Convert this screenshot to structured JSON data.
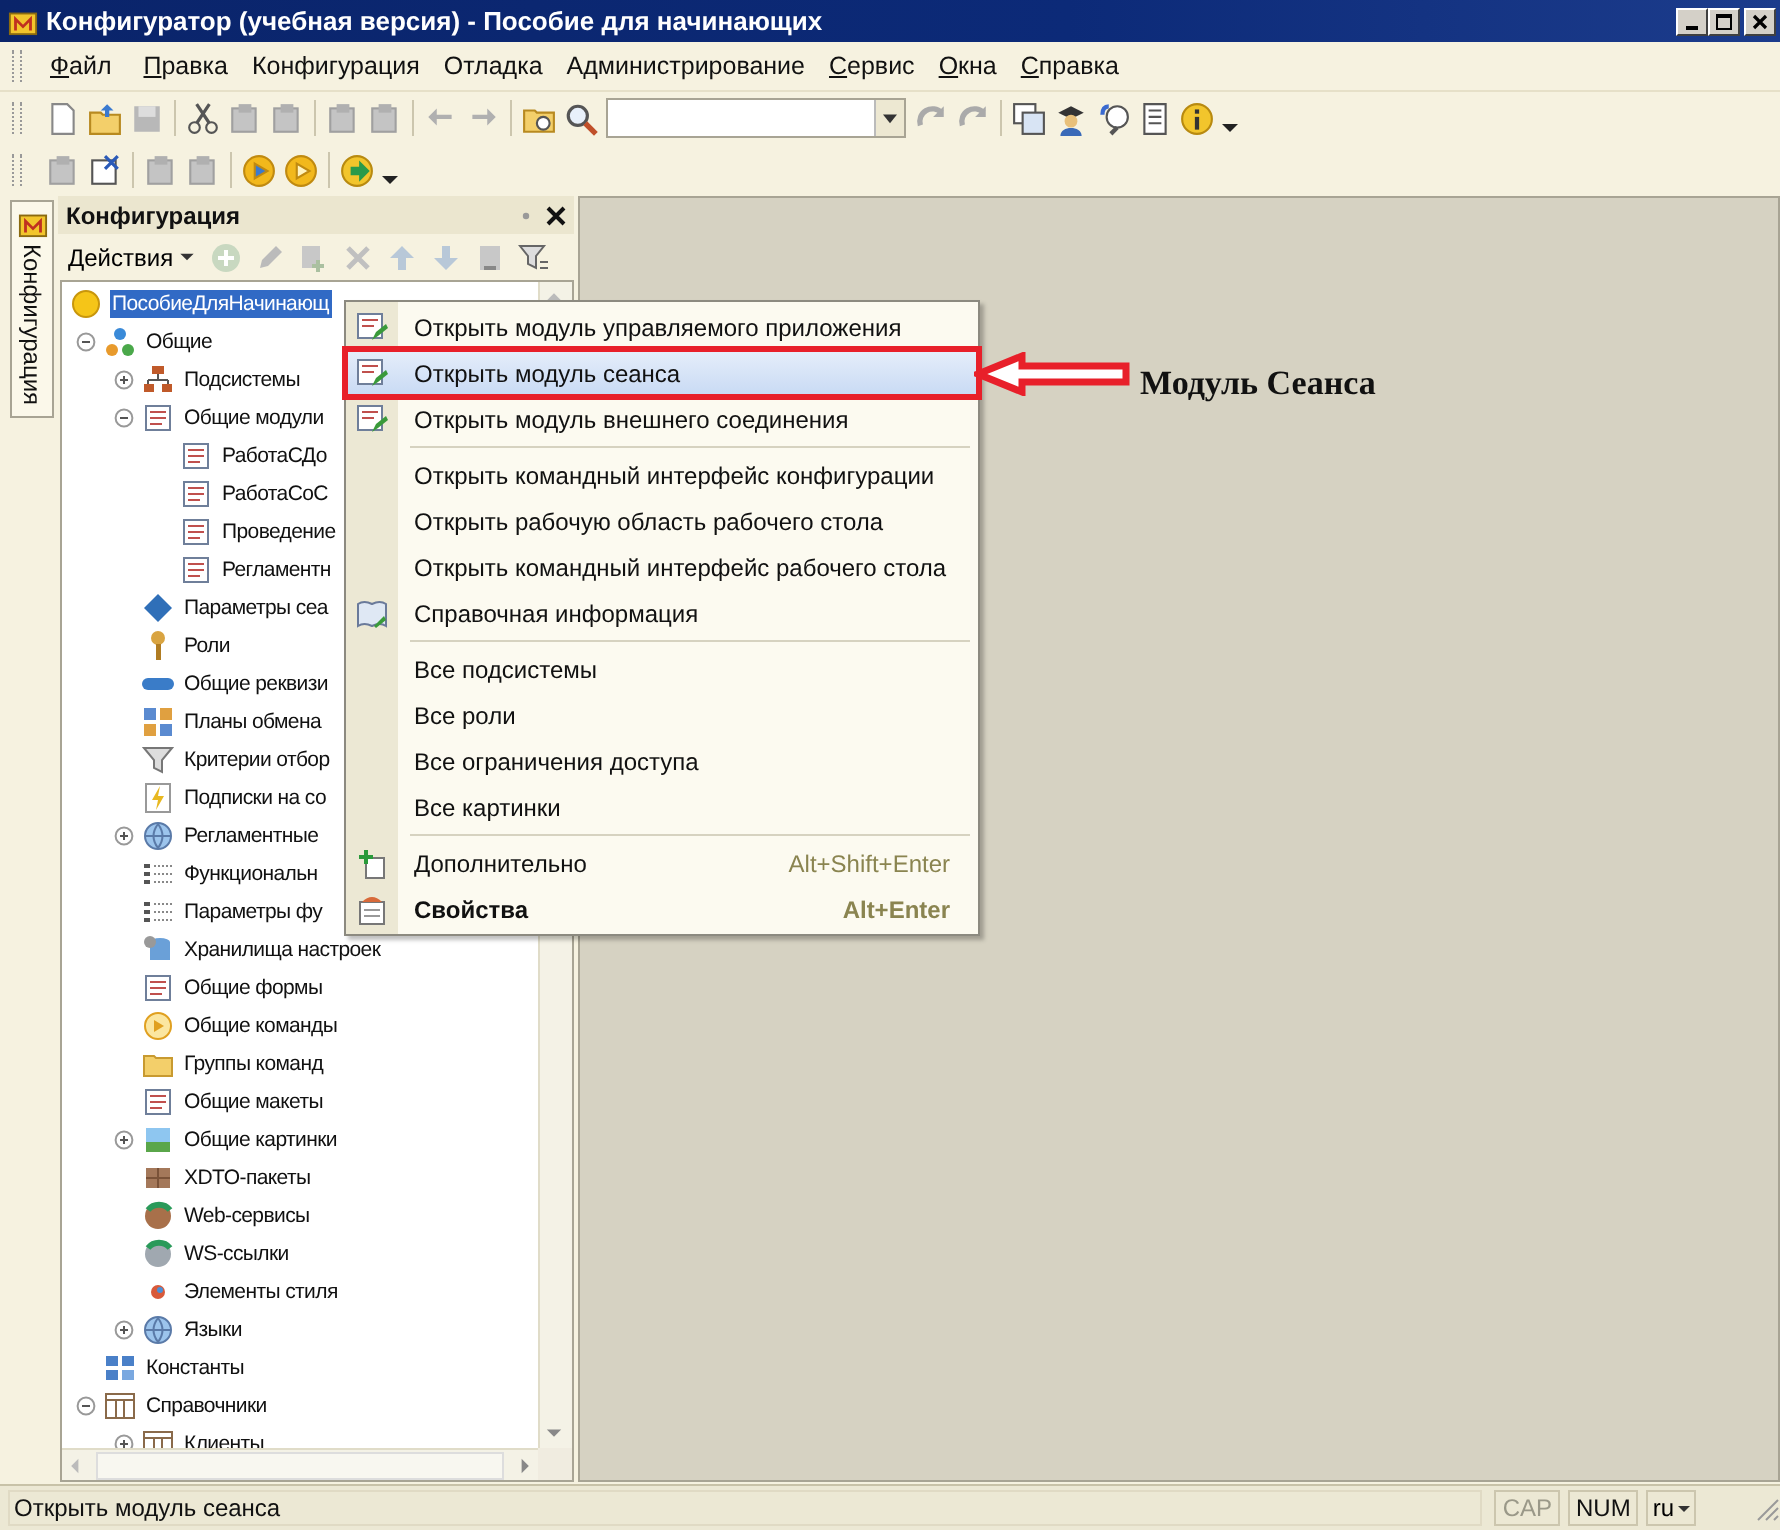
{
  "window": {
    "title": "Конфигуратор (учебная версия) - Пособие для начинающих"
  },
  "menu_bar": [
    {
      "label": "Файл",
      "mnemonic": true
    },
    {
      "label": "Правка",
      "mnemonic": true
    },
    {
      "label": "Конфигурация",
      "mnemonic": false
    },
    {
      "label": "Отладка",
      "mnemonic": false
    },
    {
      "label": "Администрирование",
      "mnemonic": false
    },
    {
      "label": "Сервис",
      "mnemonic": true
    },
    {
      "label": "Окна",
      "mnemonic": true
    },
    {
      "label": "Справка",
      "mnemonic": true
    }
  ],
  "side_tab": {
    "label": "Конфигурация"
  },
  "panel": {
    "title": "Конфигурация",
    "actions_label": "Действия",
    "tree": [
      {
        "label": "ПособиеДляНачинающ",
        "selected": true,
        "children": [
          {
            "label": "Общие",
            "selected": false,
            "expanded": true,
            "children": [
              {
                "label": "Подсистемы",
                "selected": false,
                "expanded": false
              },
              {
                "label": "Общие модули",
                "selected": false,
                "expanded": true,
                "children": [
                  {
                    "label": "РаботаСДо",
                    "selected": false
                  },
                  {
                    "label": "РаботаСоС",
                    "selected": false
                  },
                  {
                    "label": "Проведение",
                    "selected": false
                  },
                  {
                    "label": "Регламентн",
                    "selected": false
                  }
                ]
              },
              {
                "label": "Параметры сеа",
                "selected": false
              },
              {
                "label": "Роли",
                "selected": false
              },
              {
                "label": "Общие реквизи",
                "selected": false
              },
              {
                "label": "Планы обмена",
                "selected": false
              },
              {
                "label": "Критерии отбор",
                "selected": false
              },
              {
                "label": "Подписки на со",
                "selected": false
              },
              {
                "label": "Регламентные",
                "selected": false,
                "expanded": false
              },
              {
                "label": "Функциональн",
                "selected": false
              },
              {
                "label": "Параметры фу",
                "selected": false
              },
              {
                "label": "Хранилища настроек",
                "selected": false
              },
              {
                "label": "Общие формы",
                "selected": false
              },
              {
                "label": "Общие команды",
                "selected": false
              },
              {
                "label": "Группы команд",
                "selected": false
              },
              {
                "label": "Общие макеты",
                "selected": false
              },
              {
                "label": "Общие картинки",
                "selected": false,
                "expanded": false
              },
              {
                "label": "XDTO-пакеты",
                "selected": false
              },
              {
                "label": "Web-сервисы",
                "selected": false
              },
              {
                "label": "WS-ссылки",
                "selected": false
              },
              {
                "label": "Элементы стиля",
                "selected": false
              },
              {
                "label": "Языки",
                "selected": false,
                "expanded": false
              }
            ]
          },
          {
            "label": "Константы",
            "selected": false
          },
          {
            "label": "Справочники",
            "selected": false,
            "expanded": true,
            "children": [
              {
                "label": "Клиенты",
                "selected": false,
                "expanded": false
              }
            ]
          }
        ]
      }
    ]
  },
  "context_menu": {
    "groups": [
      [
        {
          "label": "Открыть модуль управляемого приложения",
          "selected": false
        },
        {
          "label": "Открыть модуль сеанса",
          "selected": true
        },
        {
          "label": "Открыть модуль внешнего соединения",
          "selected": false
        }
      ],
      [
        {
          "label": "Открыть командный интерфейс конфигурации",
          "selected": false
        },
        {
          "label": "Открыть рабочую область рабочего стола",
          "selected": false
        },
        {
          "label": "Открыть командный интерфейс рабочего стола",
          "selected": false
        },
        {
          "label": "Справочная информация",
          "selected": false
        }
      ],
      [
        {
          "label": "Все подсистемы",
          "selected": false
        },
        {
          "label": "Все роли",
          "selected": false
        },
        {
          "label": "Все ограничения доступа",
          "selected": false
        },
        {
          "label": "Все картинки",
          "selected": false
        }
      ],
      [
        {
          "label": "Дополнительно",
          "shortcut": "Alt+Shift+Enter",
          "selected": false,
          "default": false
        },
        {
          "label": "Свойства",
          "shortcut": "Alt+Enter",
          "selected": false,
          "default": true
        }
      ]
    ]
  },
  "annotation": {
    "text": "Модуль Сеанса"
  },
  "status_bar": {
    "message": "Открыть модуль сеанса",
    "indicators": [
      {
        "label": "CAP",
        "on": false
      },
      {
        "label": "NUM",
        "on": true
      }
    ],
    "language": "ru"
  }
}
